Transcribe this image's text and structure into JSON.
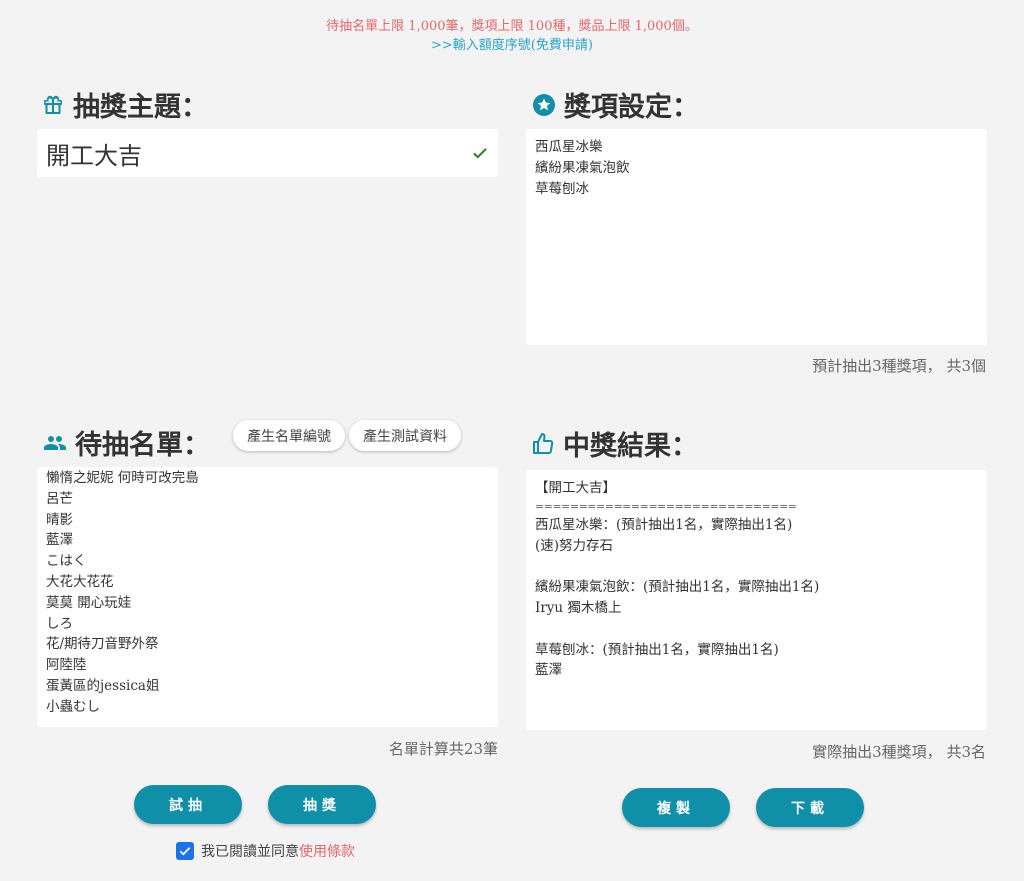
{
  "notice": {
    "limit": "待抽名單上限 1,000筆，獎項上限 100種，獎品上限 1,000個。",
    "link_prefix": ">>輸入額度序號(",
    "link_free": "免費申請",
    "link_suffix": ")"
  },
  "topic": {
    "title": "抽獎主題：",
    "value": "開工大吉"
  },
  "prizes": {
    "title": "獎項設定：",
    "items": [
      "西瓜星冰樂",
      "繽紛果凍氣泡飲",
      "草莓刨冰"
    ],
    "summary": "預計抽出3種獎項， 共3個"
  },
  "list": {
    "title": "待抽名單：",
    "gen_number_label": "產生名單編號",
    "gen_test_label": "產生測試資料",
    "entries": [
      "懶惰之妮妮 何時可改完島",
      "呂芒",
      "晴影",
      "藍澤",
      "こはく",
      "大花大花花",
      "莫莫 開心玩娃",
      "しろ",
      "花/期待刀音野外祭",
      "阿陸陸",
      "蛋黃區的jessica姐",
      "小蟲むし"
    ],
    "summary": "名單計算共23筆"
  },
  "results": {
    "title": "中獎結果：",
    "lines": [
      "【開工大吉】",
      "==============================",
      "西瓜星冰樂：(預計抽出1名，實際抽出1名)",
      "(速)努力存石",
      "",
      "繽紛果凍氣泡飲：(預計抽出1名，實際抽出1名)",
      "Iryu 獨木橋上",
      "",
      "草莓刨冰：(預計抽出1名，實際抽出1名)",
      "藍澤"
    ],
    "summary": "實際抽出3種獎項， 共3名"
  },
  "buttons": {
    "trial": "試抽",
    "draw": "抽獎",
    "copy": "複製",
    "download": "下載"
  },
  "agree": {
    "text": "我已閱讀並同意",
    "terms": "使用條款"
  },
  "colors": {
    "accent": "#0f8fa8",
    "link": "#2aa5c9",
    "warning": "#e6686b",
    "check": "#2e7d32"
  },
  "icons": {
    "topic": "gift-icon",
    "prizes": "star-badge-icon",
    "list": "people-icon",
    "results": "thumbs-up-icon",
    "valid": "checkmark-icon"
  }
}
